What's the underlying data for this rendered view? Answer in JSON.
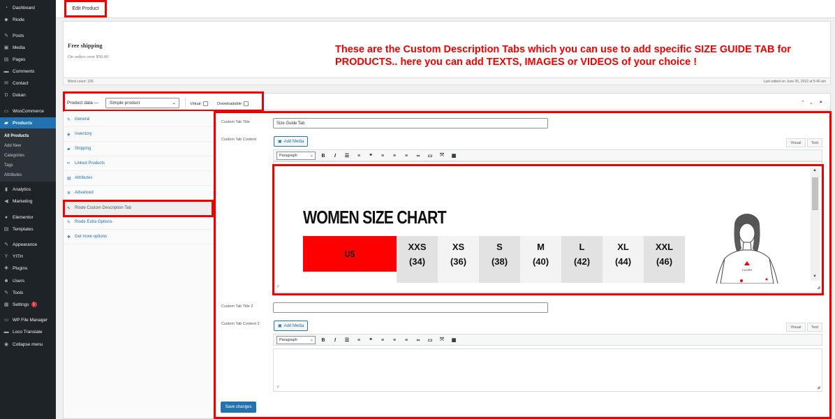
{
  "sidebar": {
    "items": [
      {
        "label": "Dashboard",
        "icon": "dashboard-icon"
      },
      {
        "label": "Riode",
        "icon": "riode-icon"
      },
      {
        "label": "Posts",
        "icon": "pin-icon"
      },
      {
        "label": "Media",
        "icon": "media-icon"
      },
      {
        "label": "Pages",
        "icon": "pages-icon"
      },
      {
        "label": "Comments",
        "icon": "comments-icon"
      },
      {
        "label": "Contact",
        "icon": "contact-icon"
      },
      {
        "label": "Dokan",
        "icon": "dokan-icon"
      },
      {
        "label": "WooCommerce",
        "icon": "woocommerce-icon"
      },
      {
        "label": "Products",
        "icon": "products-icon"
      },
      {
        "label": "Analytics",
        "icon": "analytics-icon"
      },
      {
        "label": "Marketing",
        "icon": "marketing-icon"
      },
      {
        "label": "Elementor",
        "icon": "elementor-icon"
      },
      {
        "label": "Templates",
        "icon": "templates-icon"
      },
      {
        "label": "Appearance",
        "icon": "appearance-icon"
      },
      {
        "label": "YITH",
        "icon": "yith-icon"
      },
      {
        "label": "Plugins",
        "icon": "plugins-icon"
      },
      {
        "label": "Users",
        "icon": "users-icon"
      },
      {
        "label": "Tools",
        "icon": "tools-icon"
      },
      {
        "label": "Settings",
        "icon": "settings-icon",
        "badge": "1"
      },
      {
        "label": "WP File Manager",
        "icon": "file-manager-icon"
      },
      {
        "label": "Loco Translate",
        "icon": "translate-icon"
      },
      {
        "label": "Collapse menu",
        "icon": "collapse-icon"
      }
    ],
    "products_submenu": [
      "All Products",
      "Add New",
      "Categories",
      "Tags",
      "Attributes"
    ]
  },
  "header": {
    "edit_product": "Edit Product"
  },
  "description": {
    "free_shipping": "Free shipping",
    "free_shipping_sub": "On orders over $50.00",
    "word_count": "Word count: 106",
    "last_edited": "Last edited on June 25, 2022 at 5:40 am"
  },
  "annotation": "These are the Custom Description Tabs which you can use to add specific SIZE GUIDE TAB for PRODUCTS.. here you can add TEXTS, IMAGES or VIDEOS of your choice !",
  "product_data": {
    "label": "Product data —",
    "type_selected": "Simple product",
    "virtual_label": "Virtual:",
    "downloadable_label": "Downloadable:"
  },
  "tabs": [
    {
      "label": "General",
      "icon": "wrench-icon"
    },
    {
      "label": "Inventory",
      "icon": "diamond-icon"
    },
    {
      "label": "Shipping",
      "icon": "truck-icon"
    },
    {
      "label": "Linked Products",
      "icon": "link-icon"
    },
    {
      "label": "Attributes",
      "icon": "list-icon"
    },
    {
      "label": "Advanced",
      "icon": "gear-icon"
    },
    {
      "label": "Riode Custom Description Tab",
      "icon": "wrench-icon"
    },
    {
      "label": "Riode Extra Options",
      "icon": "wrench-icon"
    },
    {
      "label": "Get more options",
      "icon": "plugin-icon"
    }
  ],
  "custom_tab": {
    "title_label": "Custom Tab Title",
    "title_value": "Size Guide Tab",
    "content_label": "Custom Tab Content",
    "title2_label": "Custom Tab Title 2",
    "title2_value": "",
    "content2_label": "Custom Tab Content 2",
    "add_media": "Add Media",
    "visual": "Visual",
    "text": "Text",
    "paragraph": "Paragraph",
    "path_p": "P",
    "save": "Save changes"
  },
  "size_chart": {
    "title": "WOMEN SIZE CHART",
    "region": "US",
    "sizes": [
      {
        "size": "XXS",
        "num": "(34)"
      },
      {
        "size": "XS",
        "num": "(36)"
      },
      {
        "size": "S",
        "num": "(38)"
      },
      {
        "size": "M",
        "num": "(40)"
      },
      {
        "size": "L",
        "num": "(42)"
      },
      {
        "size": "XL",
        "num": "(44)"
      },
      {
        "size": "XXL",
        "num": "(46)"
      }
    ],
    "figure_logo": "CUORE"
  }
}
